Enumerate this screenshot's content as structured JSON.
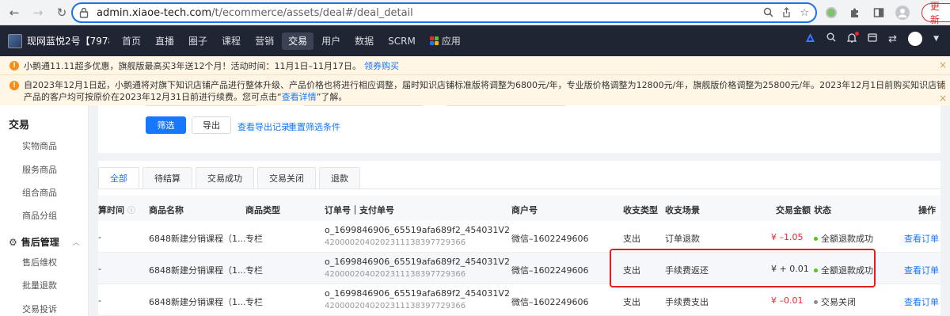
{
  "browser": {
    "url_host": "admin.xiaoe-tech.com",
    "url_path": "/t/ecommerce/assets/deal#/deal_detail",
    "update_label": "更新",
    "icons": [
      "back-icon",
      "forward-icon",
      "reload-icon",
      "lock-icon",
      "zoom-icon",
      "share-icon",
      "bookmark-star-icon",
      "extension-icon",
      "puzzle-icon",
      "sidebar-icon",
      "profile-icon",
      "menu-icon"
    ]
  },
  "topnav": {
    "store_name": "现网蓝悦2号【7978...",
    "items": [
      "首页",
      "直播",
      "圈子",
      "课程",
      "营销",
      "交易",
      "用户",
      "数据",
      "SCRM",
      "应用"
    ],
    "active": "交易",
    "app_grid_colors": [
      "#f5222d",
      "#52c41a",
      "#1677ff",
      "#faad14"
    ]
  },
  "notices": {
    "n1_text": "小鹅通11.11超多优惠，旗舰版最高买3年送12个月！活动时间：11月1日–11月17日。",
    "n1_link": "领券购买",
    "n2_text_a": "自2023年12月1日起，小鹅通将对旗下知识店铺产品进行整体升级、产品价格也将进行相应调整，届时知识店铺标准版将调整为6800元/年，专业版价格调整为12800元/年，旗舰版价格调整为25800元/年。2023年12月1日前购买知识店铺产品的客户均可按原价在2023年12月31日前进行续费。您可点击“",
    "n2_link": "查看详情",
    "n2_text_b": "”了解。"
  },
  "sidebar": {
    "title": "交易",
    "items": [
      "实物商品",
      "服务商品",
      "组合商品",
      "商品分组"
    ],
    "section": "售后管理",
    "section_items": [
      "售后维权",
      "批量退款",
      "交易投诉"
    ]
  },
  "filter": {
    "filter_btn": "筛选",
    "export_btn": "导出",
    "export_log": "查看导出记录",
    "reset": "重置筛选条件"
  },
  "tabs": [
    "全部",
    "待结算",
    "交易成功",
    "交易关闭",
    "退款"
  ],
  "active_tab": "全部",
  "table": {
    "headers": {
      "time": "算时间",
      "name": "商品名称",
      "type": "商品类型",
      "order": "订单号｜支付单号",
      "merchant": "商户号",
      "direction": "收支类型",
      "scene": "收支场景",
      "amount": "交易金额",
      "status": "状态",
      "action": "操作"
    },
    "rows": [
      {
        "time": "-",
        "name": "6848新建分销课程（1...",
        "type": "专栏",
        "order": "o_1699846906_65519afa689f2_454031V2",
        "pay": "4200002040202311138397729366",
        "merchant": "微信–1602249606",
        "direction": "支出",
        "scene": "订单退款",
        "amount": "¥ –1.05",
        "amount_sign": "neg",
        "status": "全额退款成功",
        "status_color": "#52c41a",
        "action": "查看订单"
      },
      {
        "time": "-",
        "name": "6848新建分销课程（1...",
        "type": "专栏",
        "order": "o_1699846906_65519afa689f2_454031V2",
        "pay": "4200002040202311138397729366",
        "merchant": "微信–1602249606",
        "direction": "支出",
        "scene": "手续费返还",
        "amount": "¥ + 0.01",
        "amount_sign": "pos",
        "status": "全额退款成功",
        "status_color": "#52c41a",
        "action": "查看订单"
      },
      {
        "time": "-",
        "name": "6848新建分销课程（1...",
        "type": "专栏",
        "order": "o_1699846906_65519afa689f2_454031V2",
        "pay": "4200002040202311138397729366",
        "merchant": "微信–1602249606",
        "direction": "支出",
        "scene": "手续费支出",
        "amount": "¥ –0.01",
        "amount_sign": "neg",
        "status": "交易关闭",
        "status_color": "#8c8c8c",
        "action": "查看订单"
      }
    ]
  }
}
